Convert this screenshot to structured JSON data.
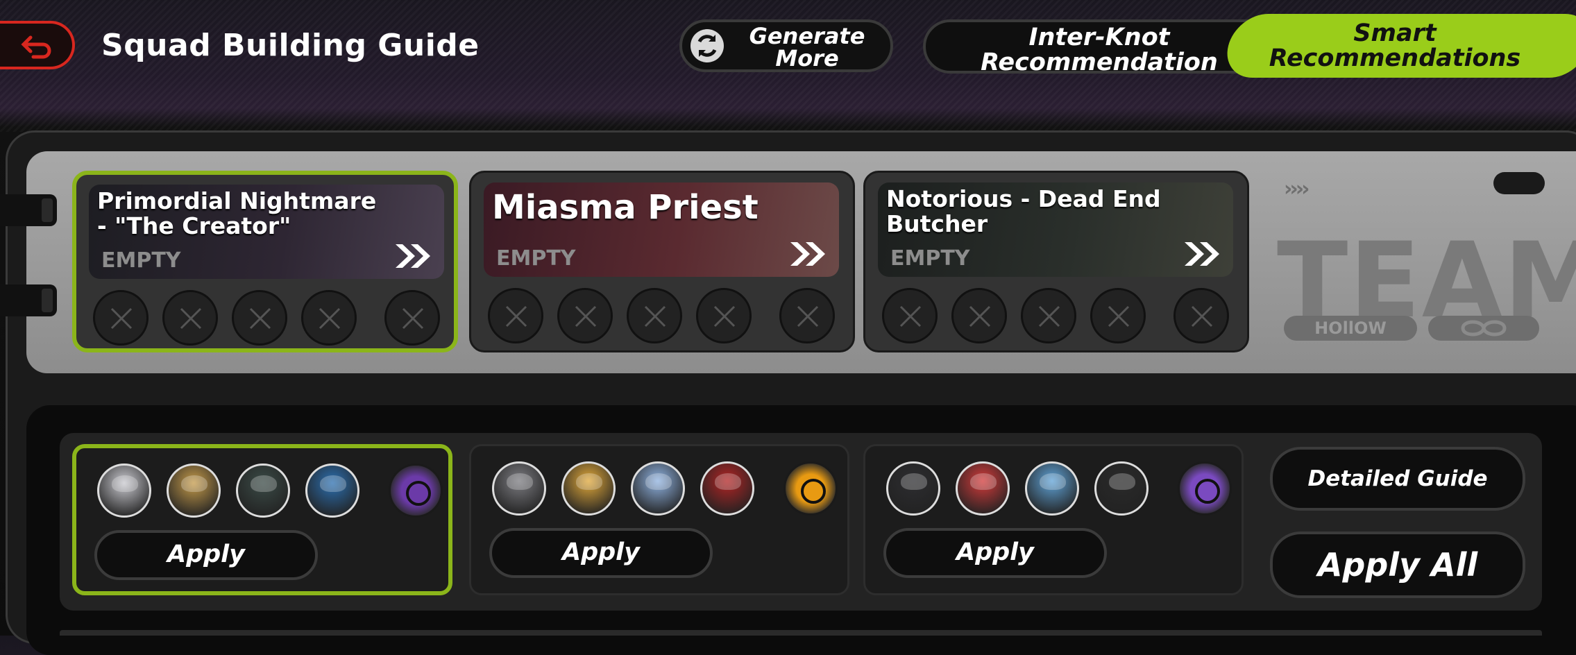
{
  "header": {
    "title": "Squad Building Guide",
    "generate_label": "Generate\nMore",
    "tabs": [
      {
        "label": "Inter-Knot\nRecommendation",
        "active": false
      },
      {
        "label": "Smart\nRecommendations",
        "active": true
      }
    ]
  },
  "bosses": [
    {
      "name": "Primordial Nightmare - \"The Creator\"",
      "status": "EMPTY",
      "selected": true
    },
    {
      "name": "Miasma Priest",
      "status": "EMPTY",
      "selected": false
    },
    {
      "name": "Notorious - Dead End Butcher",
      "status": "EMPTY",
      "selected": false
    }
  ],
  "team_badge": {
    "logo": "TEAM",
    "tag": "HOllOW",
    "arrows": "››››"
  },
  "recommendations": [
    {
      "apply_label": "Apply",
      "selected": true,
      "avatars": [
        "#c9c9cf",
        "#c49a4a",
        "#3a4a46",
        "#2b6fb0"
      ],
      "bangboo_color": "#6b3aa8"
    },
    {
      "apply_label": "Apply",
      "selected": false,
      "avatars": [
        "#7b7b80",
        "#e0a83a",
        "#8fb2e0",
        "#b22424"
      ],
      "bangboo_color": "#e89a12"
    },
    {
      "apply_label": "Apply",
      "selected": false,
      "avatars": [
        "#2d2d30",
        "#d23a3a",
        "#5fa2d6",
        "#2a2a2a"
      ],
      "bangboo_color": "#7a4ac0"
    }
  ],
  "actions": {
    "detailed_guide": "Detailed Guide",
    "apply_all": "Apply All"
  },
  "colors": {
    "accent": "#9acd1a",
    "back": "#d8271f"
  }
}
